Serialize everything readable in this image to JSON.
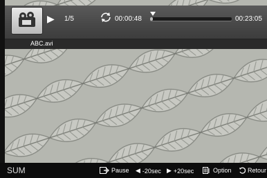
{
  "player": {
    "index": "1/5",
    "elapsed": "00:00:48",
    "total": "00:23:05",
    "progress_fraction": 0.03,
    "filename": "ABC.avi"
  },
  "bottom": {
    "left_label": "SUM",
    "pause": "Pause",
    "back": "-20sec",
    "fwd": "+20sec",
    "option": "Option",
    "return": "Retour"
  },
  "colors": {
    "bar": "#474747",
    "bottom_bar": "#0c0c0c"
  },
  "icons": [
    "film-thumbnail-icon",
    "play-icon",
    "repeat-icon",
    "pause-key-icon",
    "rewind-icon",
    "forward-icon",
    "option-icon",
    "return-icon"
  ]
}
